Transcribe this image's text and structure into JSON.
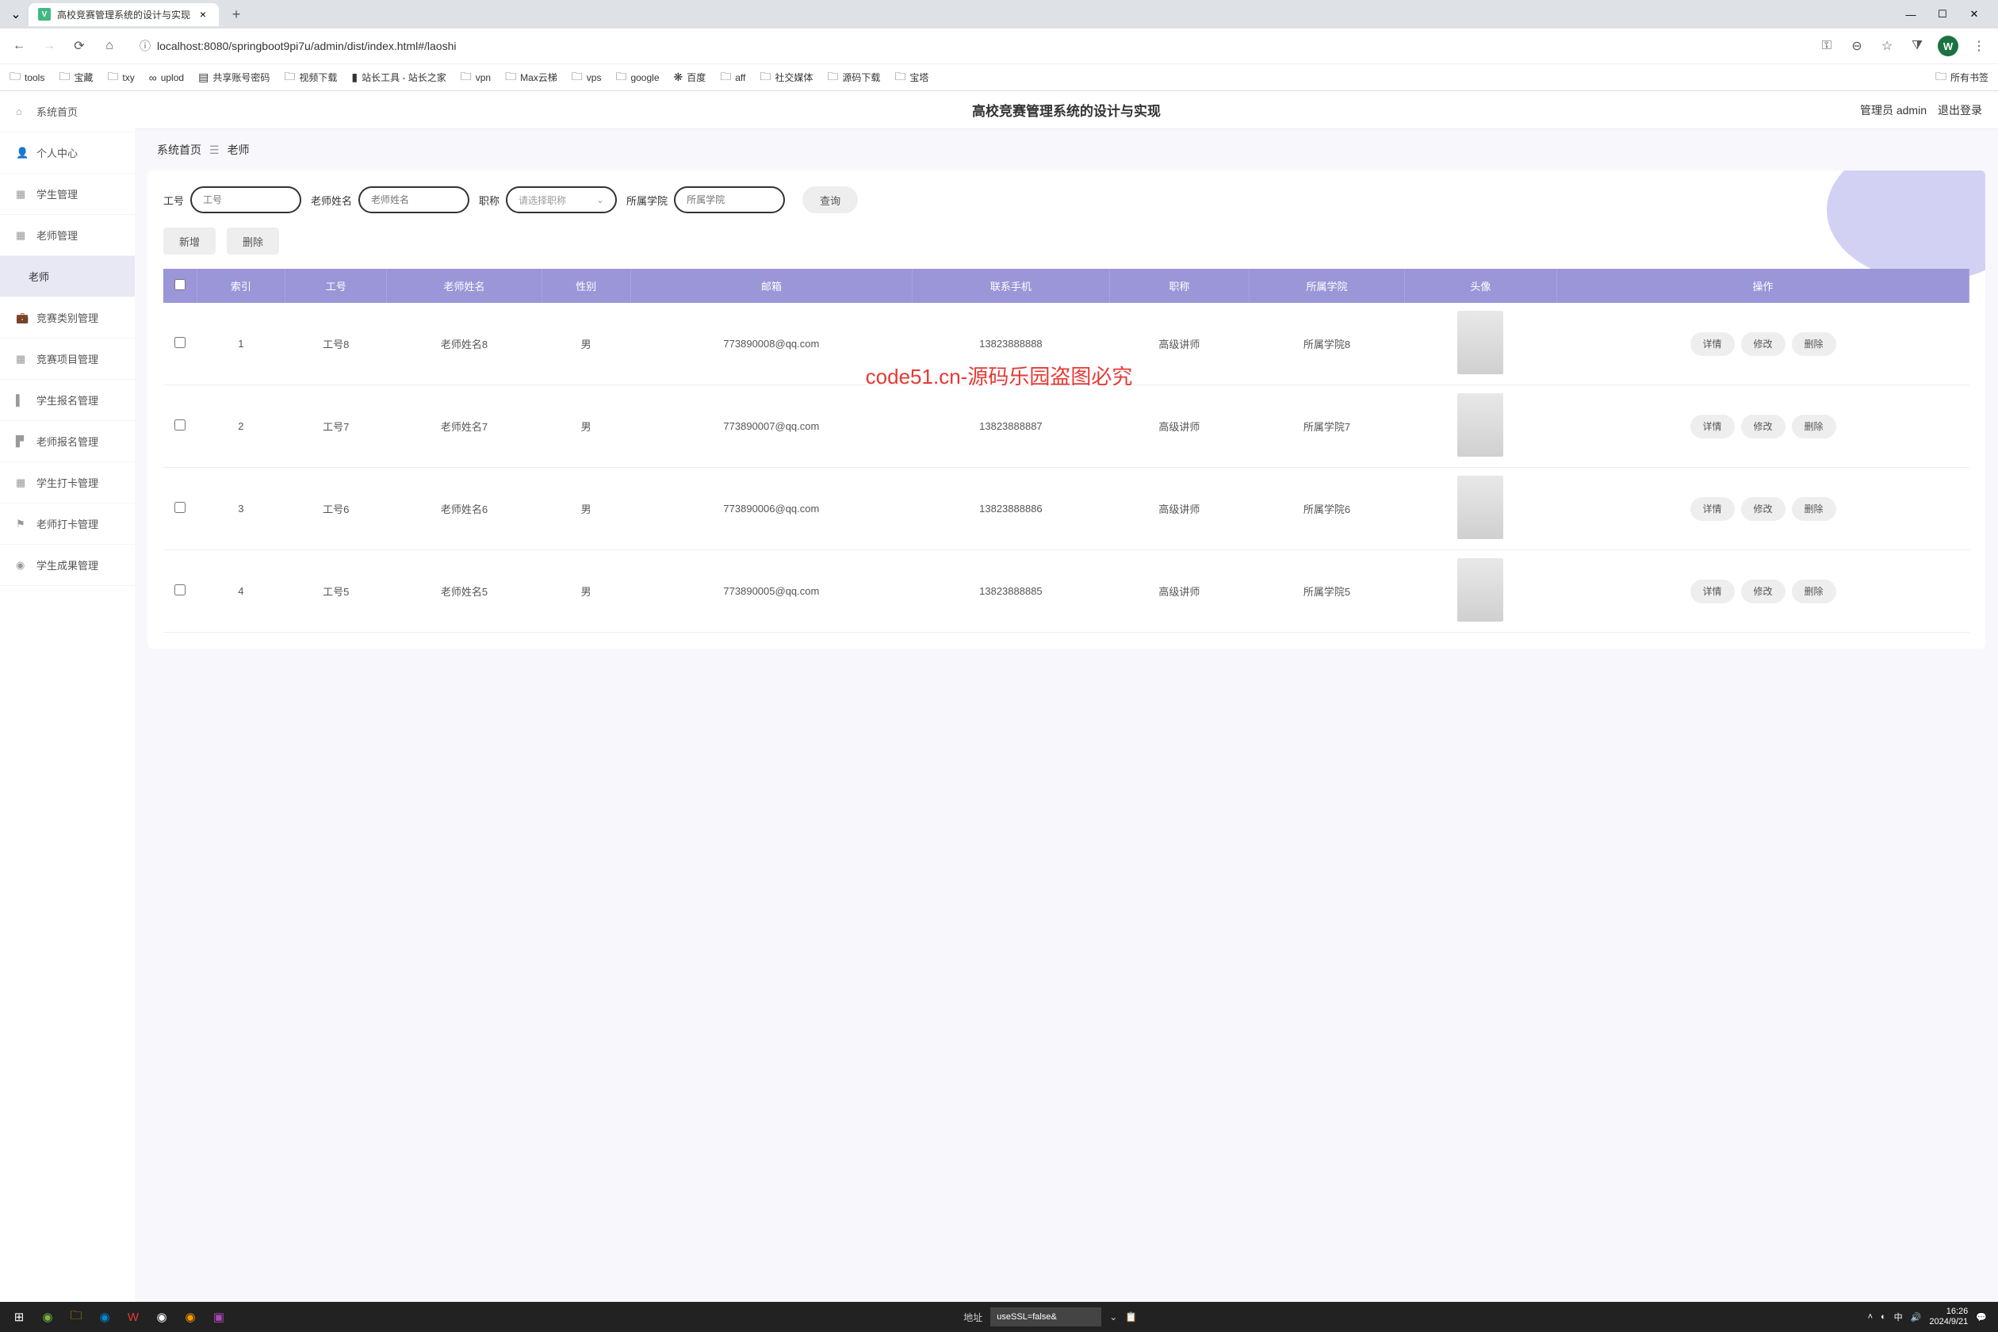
{
  "browser": {
    "tab_title": "高校竞赛管理系统的设计与实现",
    "url": "localhost:8080/springboot9pi7u/admin/dist/index.html#/laoshi",
    "profile": "W",
    "bookmarks": [
      "tools",
      "宝藏",
      "txy",
      "uplod",
      "共享账号密码",
      "视频下载",
      "站长工具 - 站长之家",
      "vpn",
      "Max云梯",
      "vps",
      "google",
      "百度",
      "aff",
      "社交媒体",
      "源码下载",
      "宝塔"
    ],
    "bookmark_right": "所有书签"
  },
  "header": {
    "title": "高校竞赛管理系统的设计与实现",
    "user": "管理员 admin",
    "logout": "退出登录"
  },
  "breadcrumb": {
    "home": "系统首页",
    "sep": "☰",
    "current": "老师"
  },
  "sidebar": {
    "items": [
      {
        "icon": "⌂",
        "label": "系统首页"
      },
      {
        "icon": "👤",
        "label": "个人中心"
      },
      {
        "icon": "▦",
        "label": "学生管理"
      },
      {
        "icon": "▦",
        "label": "老师管理"
      },
      {
        "icon": "",
        "label": "老师",
        "active": true
      },
      {
        "icon": "💼",
        "label": "竞赛类别管理"
      },
      {
        "icon": "▦",
        "label": "竞赛项目管理"
      },
      {
        "icon": "▌",
        "label": "学生报名管理"
      },
      {
        "icon": "▛",
        "label": "老师报名管理"
      },
      {
        "icon": "▦",
        "label": "学生打卡管理"
      },
      {
        "icon": "⚑",
        "label": "老师打卡管理"
      },
      {
        "icon": "◉",
        "label": "学生成果管理"
      }
    ]
  },
  "filters": {
    "f1_label": "工号",
    "f1_ph": "工号",
    "f2_label": "老师姓名",
    "f2_ph": "老师姓名",
    "f3_label": "职称",
    "f3_ph": "请选择职称",
    "f4_label": "所属学院",
    "f4_ph": "所属学院",
    "search": "查询"
  },
  "actions": {
    "add": "新增",
    "delete": "删除"
  },
  "table": {
    "headers": [
      "",
      "索引",
      "工号",
      "老师姓名",
      "性别",
      "邮箱",
      "联系手机",
      "职称",
      "所属学院",
      "头像",
      "操作"
    ],
    "rows": [
      {
        "idx": "1",
        "gonghao": "工号8",
        "name": "老师姓名8",
        "sex": "男",
        "email": "773890008@qq.com",
        "phone": "13823888888",
        "title": "高级讲师",
        "college": "所属学院8"
      },
      {
        "idx": "2",
        "gonghao": "工号7",
        "name": "老师姓名7",
        "sex": "男",
        "email": "773890007@qq.com",
        "phone": "13823888887",
        "title": "高级讲师",
        "college": "所属学院7"
      },
      {
        "idx": "3",
        "gonghao": "工号6",
        "name": "老师姓名6",
        "sex": "男",
        "email": "773890006@qq.com",
        "phone": "13823888886",
        "title": "高级讲师",
        "college": "所属学院6"
      },
      {
        "idx": "4",
        "gonghao": "工号5",
        "name": "老师姓名5",
        "sex": "男",
        "email": "773890005@qq.com",
        "phone": "13823888885",
        "title": "高级讲师",
        "college": "所属学院5"
      }
    ],
    "row_actions": {
      "detail": "详情",
      "edit": "修改",
      "del": "删除"
    }
  },
  "watermark": "code51.cn",
  "overlay": "code51.cn-源码乐园盗图必究",
  "taskbar": {
    "addr_label": "地址",
    "addr_value": "useSSL=false&",
    "time": "16:26",
    "date": "2024/9/21"
  }
}
